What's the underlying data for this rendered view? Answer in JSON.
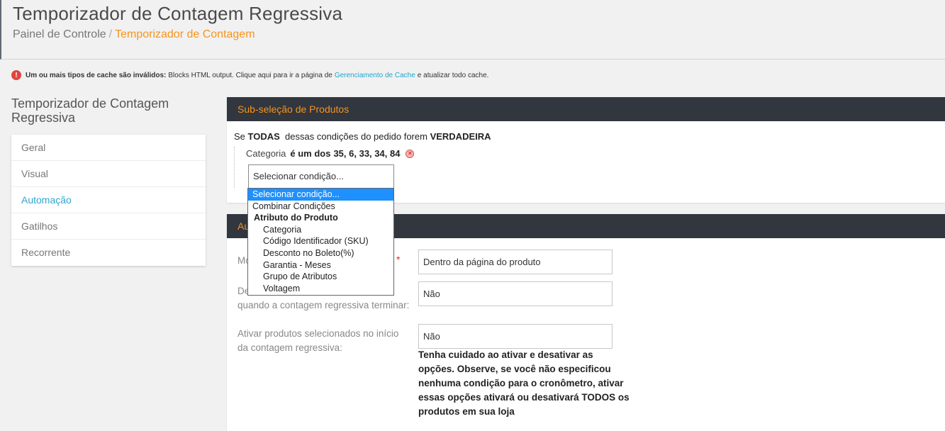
{
  "header": {
    "title": "Temporizador de Contagem Regressiva",
    "breadcrumb_root": "Painel de Controle",
    "breadcrumb_sep": "/",
    "breadcrumb_current": "Temporizador de Contagem"
  },
  "notice": {
    "icon": "!",
    "bold": "Um ou mais tipos de cache são inválidos:",
    "text_before": "Blocks HTML output. Clique aqui para ir a página de",
    "link": "Gerenciamento de Cache",
    "text_after": "e atualizar todo cache."
  },
  "sidebar": {
    "title": "Temporizador de Contagem Regressiva",
    "items": [
      {
        "label": "Geral"
      },
      {
        "label": "Visual"
      },
      {
        "label": "Automação"
      },
      {
        "label": "Gatilhos"
      },
      {
        "label": "Recorrente"
      }
    ],
    "active_index": 2
  },
  "conditions_panel": {
    "title": "Sub-seleção de Produtos",
    "rule": {
      "prefix": "Se",
      "aggregator": "TODAS",
      "middle": "dessas condições do pedido forem",
      "value": "VERDADEIRA"
    },
    "condition": {
      "attribute": "Categoria",
      "operator": "é um dos",
      "value": "35, 6, 33, 34, 84",
      "remove_symbol": "×"
    },
    "select_placeholder": "Selecionar condição..."
  },
  "dropdown": {
    "selected": "Selecionar condição...",
    "combine": "Combinar Condições",
    "group_label": "Atributo do Produto",
    "options": [
      "Categoria",
      "Código Identificador (SKU)",
      "Desconto no Boleto(%)",
      "Garantia - Meses",
      "Grupo de Atributos",
      "Voltagem"
    ]
  },
  "automation_panel": {
    "title_visible": "Au",
    "fields": [
      {
        "label": "Mo",
        "value": "Dentro da página do produto",
        "required": true
      },
      {
        "label_line1": "De",
        "label_line2": "quando a contagem regressiva terminar:",
        "value": "Não"
      },
      {
        "label_line1": "Ativar produtos selecionados no início",
        "label_line2": "da contagem regressiva:",
        "value": "Não"
      }
    ],
    "required_mark": "*",
    "note": "Tenha cuidado ao ativar e desativar as opções. Observe, se você não especificou nenhuma condição para o cronômetro, ativar essas opções ativará ou desativará TODOS os produtos em sua loja"
  },
  "colors": {
    "accent": "#f7941d",
    "link": "#1fa6cc",
    "panel_header": "#31363f",
    "error": "#e2453c"
  }
}
